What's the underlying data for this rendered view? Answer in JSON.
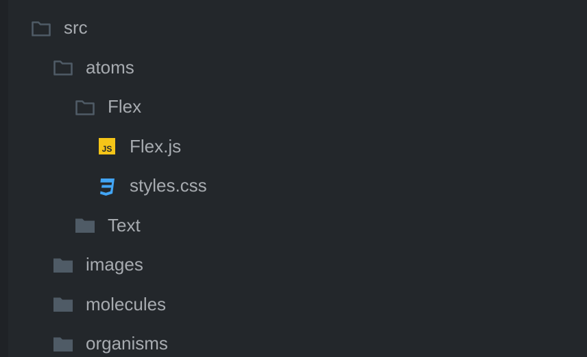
{
  "tree": {
    "items": [
      {
        "label": "src",
        "icon": "folder-open-icon",
        "level": 0
      },
      {
        "label": "atoms",
        "icon": "folder-open-icon",
        "level": 1
      },
      {
        "label": "Flex",
        "icon": "folder-open-icon",
        "level": 2
      },
      {
        "label": "Flex.js",
        "icon": "javascript-file-icon",
        "level": 3
      },
      {
        "label": "styles.css",
        "icon": "css-file-icon",
        "level": 3
      },
      {
        "label": "Text",
        "icon": "folder-closed-icon",
        "level": 2
      },
      {
        "label": "images",
        "icon": "folder-closed-icon",
        "level": 1
      },
      {
        "label": "molecules",
        "icon": "folder-closed-icon",
        "level": 1
      },
      {
        "label": "organisms",
        "icon": "folder-closed-icon",
        "level": 1
      }
    ],
    "js_badge_text": "JS"
  },
  "colors": {
    "background": "#23272b",
    "gutter": "#1f2226",
    "text": "#a7abb0",
    "folder": "#4f5b66",
    "js_badge": "#f5c518",
    "css_icon": "#42a5f5"
  }
}
